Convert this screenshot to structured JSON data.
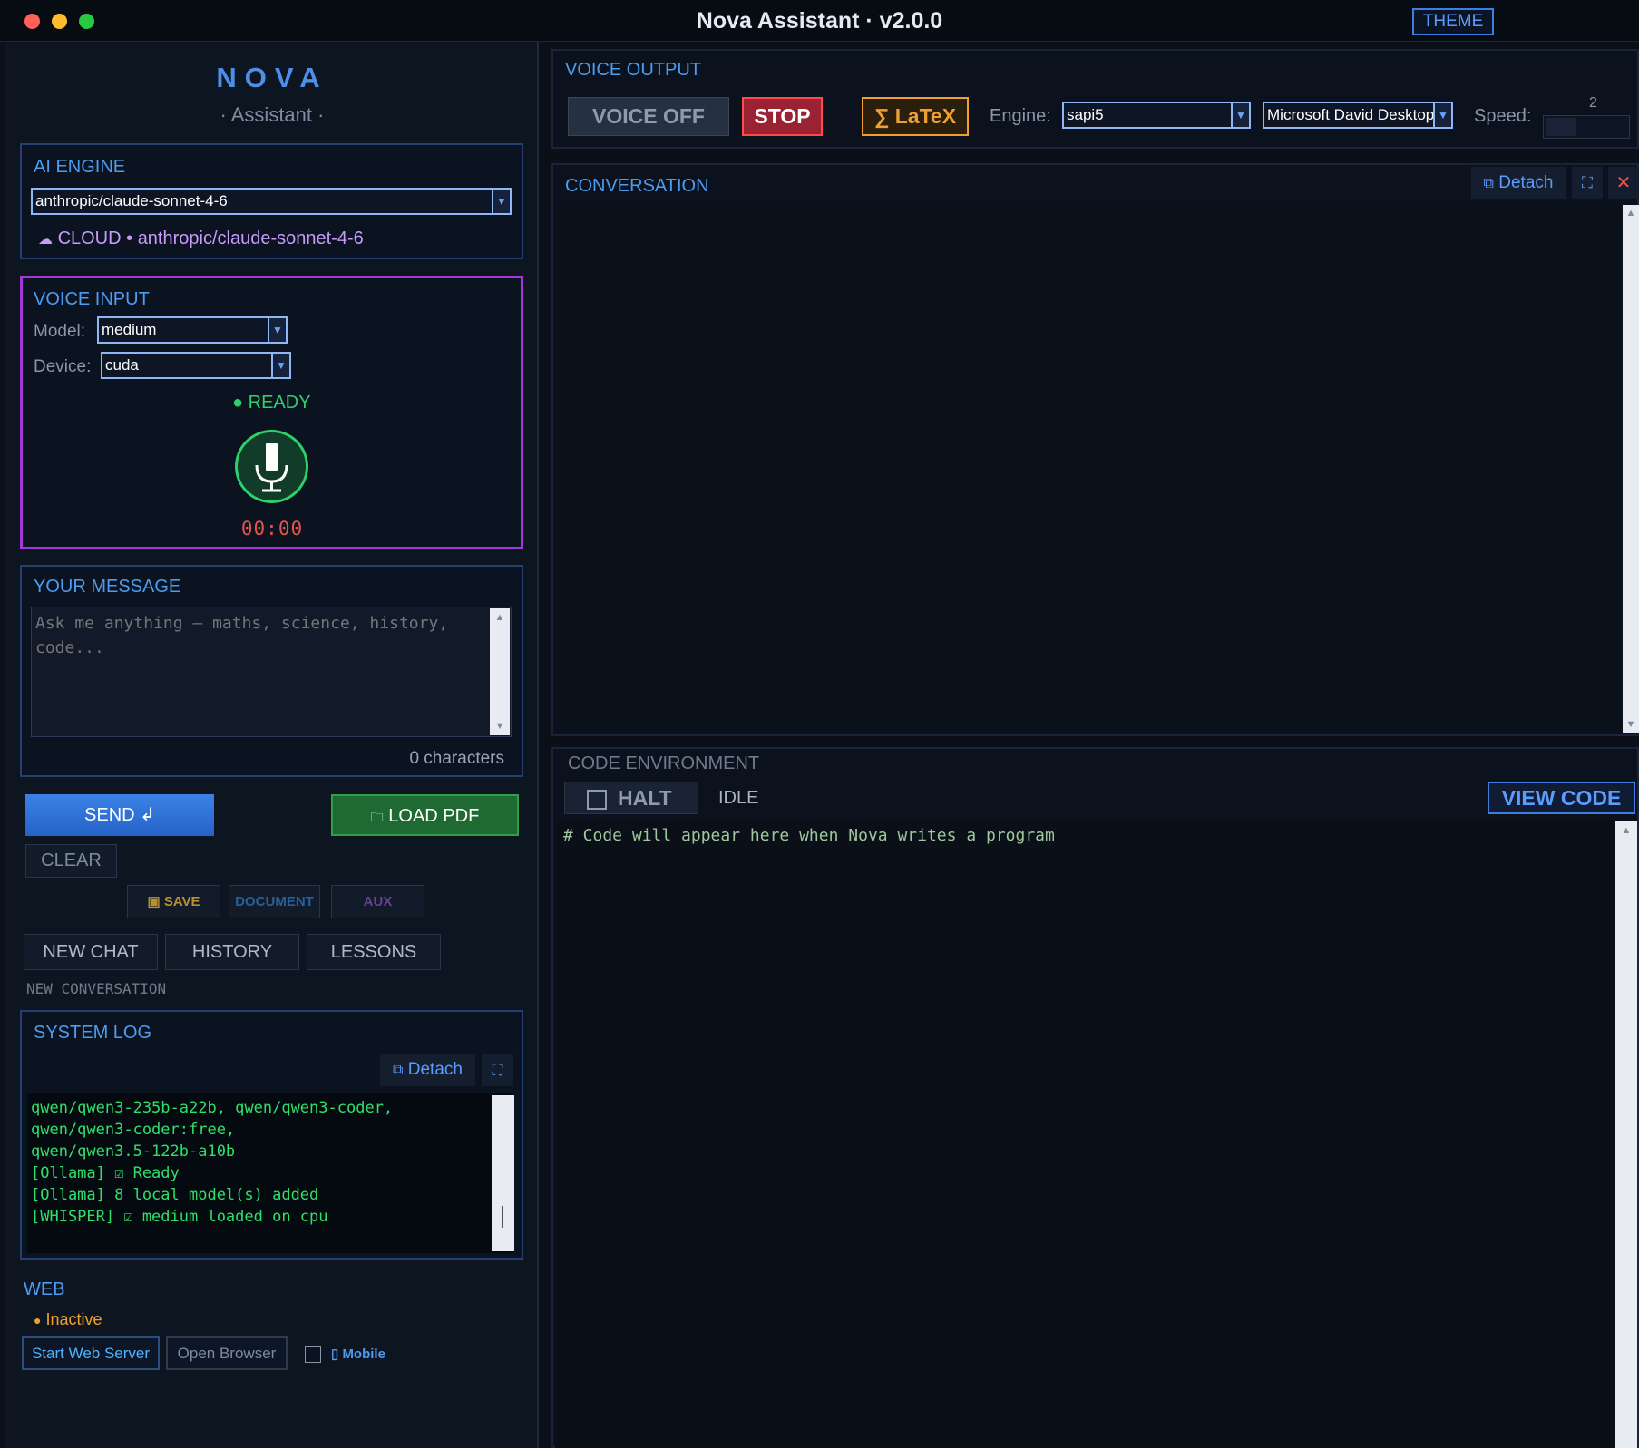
{
  "window": {
    "title": "Nova Assistant  ·  v2.0.0",
    "theme_button": "THEME"
  },
  "brand": {
    "name": "NOVA",
    "subtitle": "· Assistant ·"
  },
  "ai_engine": {
    "title": "AI ENGINE",
    "selected_model": "anthropic/claude-sonnet-4-6",
    "status": "CLOUD • anthropic/claude-sonnet-4-6"
  },
  "voice_input": {
    "title": "VOICE INPUT",
    "model_label": "Model:",
    "model_value": "medium",
    "device_label": "Device:",
    "device_value": "cuda",
    "status": "● READY",
    "timer": "00:00"
  },
  "message": {
    "title": "YOUR MESSAGE",
    "placeholder": "Ask me anything — maths, science, history, code...",
    "char_count": "0 characters"
  },
  "actions": {
    "send": "SEND ↲",
    "load_pdf": "LOAD PDF",
    "clear": "CLEAR",
    "save": "SAVE",
    "document": "DOCUMENT",
    "aux": "AUX",
    "new_chat": "NEW CHAT",
    "history": "HISTORY",
    "lessons": "LESSONS",
    "conversation_status": "NEW CONVERSATION"
  },
  "system_log": {
    "title": "SYSTEM LOG",
    "detach": "Detach",
    "lines": [
      "qwen/qwen3-235b-a22b, qwen/qwen3-coder,",
      "qwen/qwen3-coder:free,",
      "qwen/qwen3.5-122b-a10b",
      "[Ollama] ☑ Ready",
      "[Ollama] 8 local model(s) added",
      "[WHISPER] ☑ medium loaded on cpu"
    ]
  },
  "web": {
    "title": "WEB",
    "status": "Inactive",
    "start_server": "Start Web Server",
    "open_browser": "Open Browser",
    "mobile_label": "Mobile"
  },
  "voice_output": {
    "title": "VOICE OUTPUT",
    "voice_toggle": "VOICE OFF",
    "stop": "STOP",
    "latex": "∑ LaTeX",
    "engine_label": "Engine:",
    "engine_value": "sapi5",
    "voice_value": "Microsoft David Desktop",
    "speed_label": "Speed:",
    "speed_value": "2"
  },
  "conversation": {
    "title": "CONVERSATION",
    "detach": "Detach"
  },
  "code_env": {
    "title": "CODE ENVIRONMENT",
    "halt": "HALT",
    "state": "IDLE",
    "view_code": "VIEW CODE",
    "placeholder_line": "# Code will appear here when Nova writes a program"
  },
  "colors": {
    "accent_blue": "#4d9cf0",
    "voice_input_border": "#a238d8",
    "ready_green": "#2ed06a",
    "timer_red": "#e5534b",
    "log_green": "#2ee06a",
    "latex_orange": "#f0a030",
    "stop_red": "#ff4a4a",
    "load_pdf_green": "#2f9e4a"
  }
}
